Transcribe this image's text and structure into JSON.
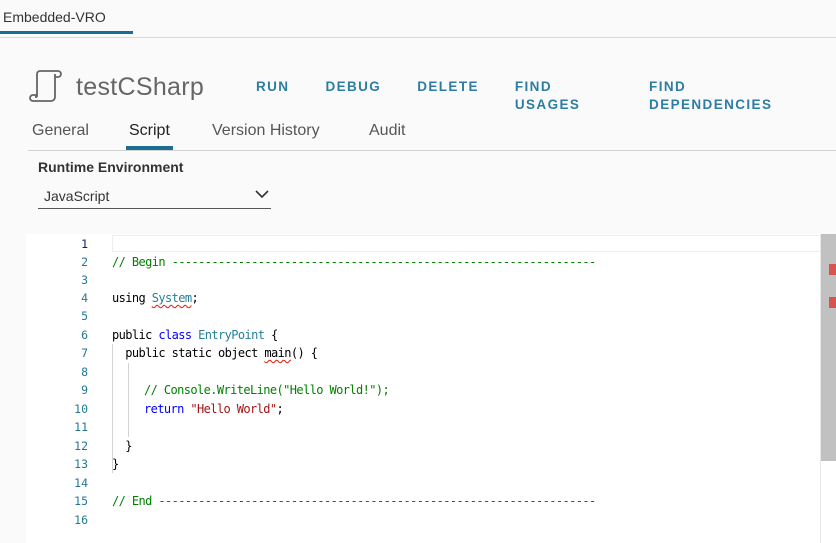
{
  "top_tab": {
    "label": "Embedded-VRO"
  },
  "header": {
    "title": "testCSharp",
    "icon": "workflow-scroll-icon",
    "actions": [
      "RUN",
      "DEBUG",
      "DELETE",
      "FIND USAGES",
      "FIND DEPENDENCIES"
    ]
  },
  "subtabs": [
    {
      "label": "General",
      "active": false
    },
    {
      "label": "Script",
      "active": true
    },
    {
      "label": "Version History",
      "active": false
    },
    {
      "label": "Audit",
      "active": false
    }
  ],
  "runtime": {
    "label": "Runtime Environment",
    "selected": "JavaScript"
  },
  "editor": {
    "line_numbers": [
      "1",
      "2",
      "3",
      "4",
      "5",
      "6",
      "7",
      "8",
      "9",
      "10",
      "11",
      "12",
      "13",
      "14",
      "15",
      "16"
    ],
    "lines": [
      "",
      "// Begin ----------------------------------------------------------------",
      "",
      "using System;",
      "",
      "public class EntryPoint {",
      "  public static object main() {",
      "",
      "    // Console.WriteLine(\"Hello World!\");",
      "    return \"Hello World\";",
      "",
      "  }",
      "}",
      "",
      "// End ------------------------------------------------------------------",
      ""
    ],
    "tokens": {
      "begin_comment": "// Begin ----------------------------------------------------------------",
      "using_kw": "using ",
      "system": "System",
      "semicolon": ";",
      "public1": "public ",
      "class_kw": "class",
      "entry_point": "EntryPoint",
      "open_brace1": " {",
      "indent_public": "  public static object ",
      "main_name": "main",
      "main_rest": "() {",
      "console_comment": "// Console.WriteLine(\"Hello World!\");",
      "return_kw": "return",
      "hello_str": "\"Hello World\"",
      "close_inner": "  }",
      "close_outer": "}",
      "end_comment": "// End ------------------------------------------------------------------"
    },
    "error_markers": 2
  },
  "colors": {
    "accent": "#1b6d94",
    "action_text": "#2d7da3",
    "comment": "#008000",
    "keyword": "#0000ff",
    "type": "#267f99",
    "string": "#a31515",
    "error": "#d9534f"
  }
}
